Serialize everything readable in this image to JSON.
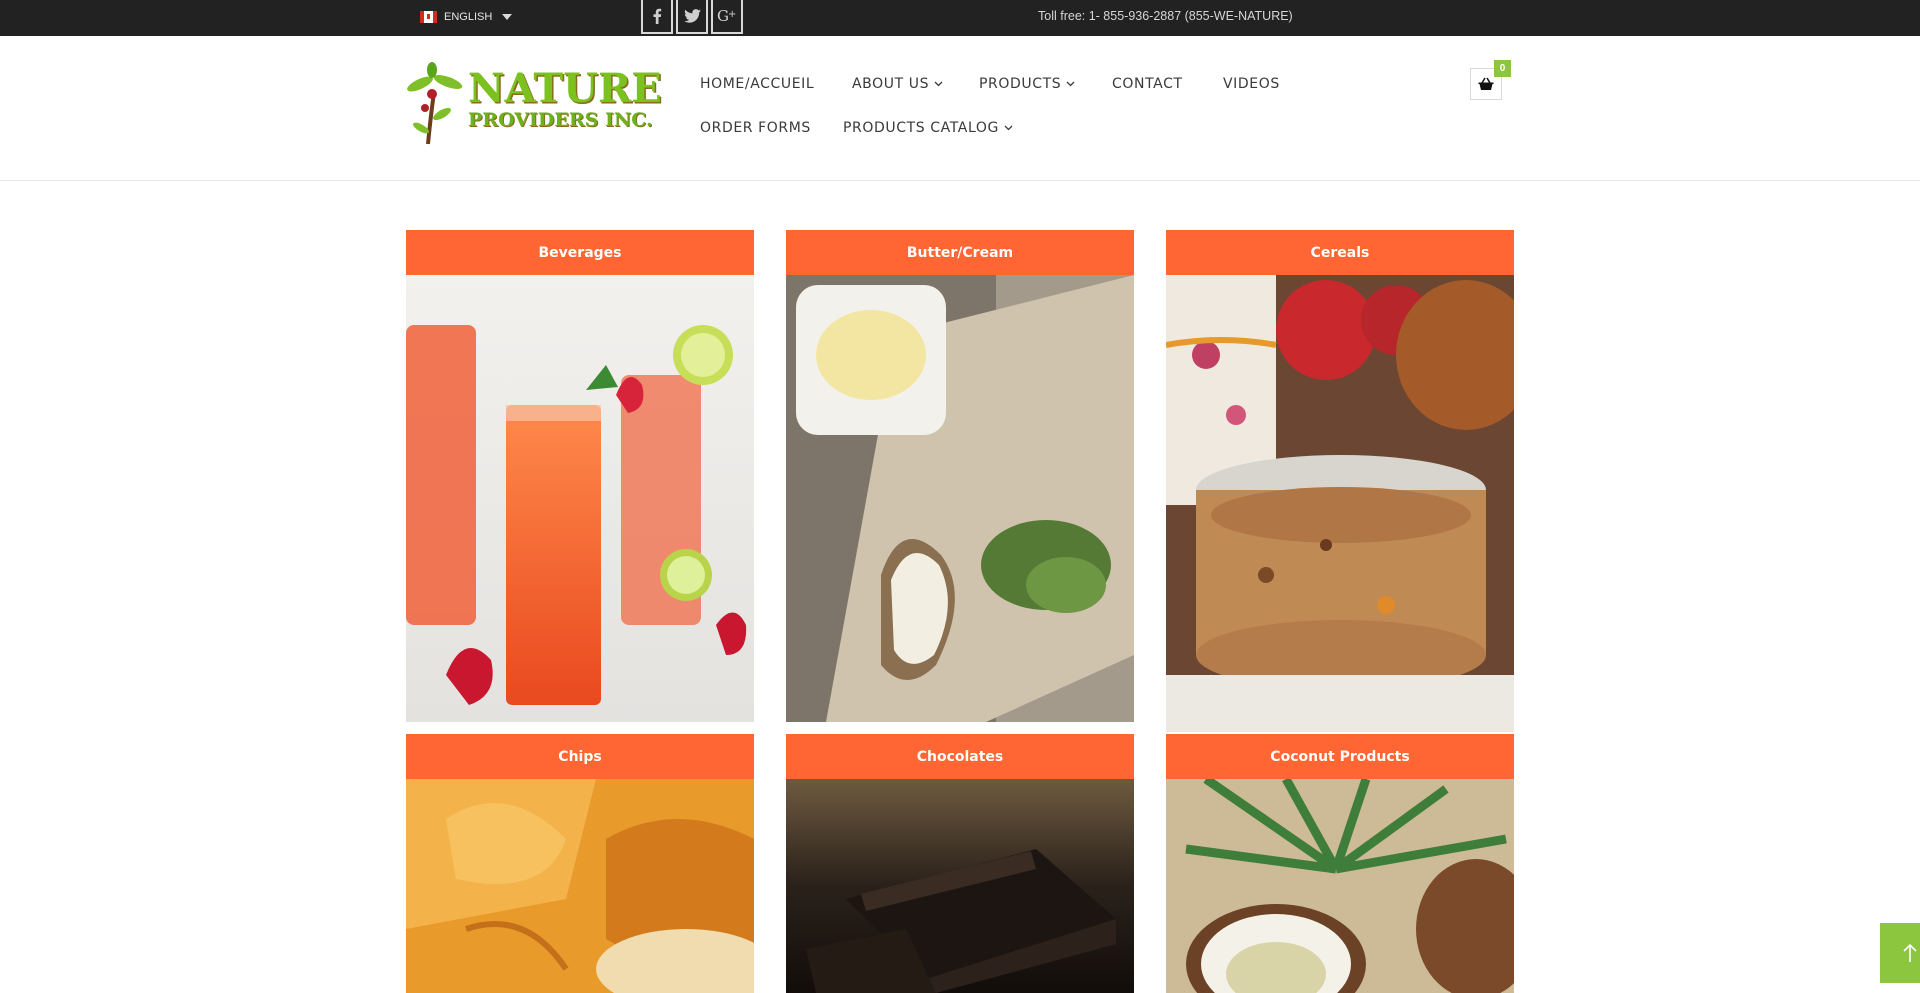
{
  "topbar": {
    "language": "ENGLISH",
    "social": [
      {
        "icon": "facebook-icon"
      },
      {
        "icon": "twitter-icon"
      },
      {
        "icon": "google-plus-icon"
      }
    ],
    "toll_free": "Toll free: 1- 855-936-2887 (855-WE-NATURE)"
  },
  "header": {
    "logo_line1": "NATURE",
    "logo_line2": "PROVIDERS INC.",
    "nav": {
      "home": "HOME/ACCUEIL",
      "about": "ABOUT US",
      "products": "PRODUCTS",
      "contact": "CONTACT",
      "videos": "VIDEOS",
      "order_forms": "ORDER FORMS",
      "catalog": "PRODUCTS CATALOG"
    },
    "cart_count": "0"
  },
  "categories": [
    {
      "label": "Beverages"
    },
    {
      "label": "Butter/Cream"
    },
    {
      "label": "Cereals"
    },
    {
      "label": "Chips"
    },
    {
      "label": "Chocolates"
    },
    {
      "label": "Coconut Products"
    }
  ],
  "colors": {
    "topbar": "#222222",
    "accent": "#ff6633",
    "green": "#8cc63f"
  }
}
